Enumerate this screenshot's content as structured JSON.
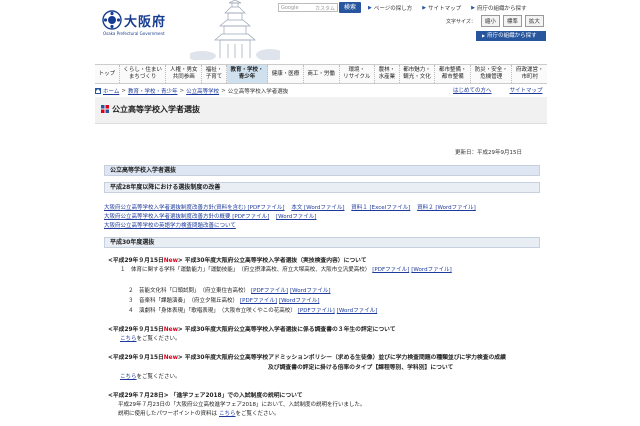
{
  "header": {
    "logo_text": "大阪府",
    "logo_sub": "Osaka Prefectural Government",
    "search_placeholder": "Google",
    "search_hint": "カスタム",
    "search_button": "検索",
    "util_links": [
      "ページの探し方",
      "サイトマップ",
      "府庁の組織から探す"
    ],
    "textsize_label": "文字サイズ：",
    "textsize_buttons": [
      "縮小",
      "標準",
      "拡大"
    ],
    "lang_label": "府庁の組織から探す"
  },
  "nav": {
    "items": [
      "トップ",
      "くらし・住まい\nまちづくり",
      "人権・男女\n共同参画",
      "福祉・\n子育て",
      "教育・学校・\n青少年",
      "健康・医療",
      "商工・労働",
      "環境・\nリサイクル",
      "農林・\n水産業",
      "都市魅力・\n観光・文化",
      "都市整備・\n都市整備",
      "防災・安全・\n危機管理",
      "府政運営・\n市町村"
    ],
    "active_index": 4
  },
  "breadcrumb": {
    "items": [
      "ホーム",
      "教育・学校・青少年",
      "公立高等学校",
      "公立高等学校入学者選抜"
    ],
    "right_links": [
      "はじめての方へ",
      "サイトマップ"
    ]
  },
  "page": {
    "title": "公立高等学校入学者選抜",
    "updated": "更新日：平成29年9月15日"
  },
  "sections": {
    "main_title": "公立高等学校入学者選抜",
    "sec28_title": "平成28年度以降における選抜制度の改善",
    "sec28_line1_text": "大阪府公立高等学校入学者選抜制度改善方針(資料を含む) [PDFファイル]",
    "sec28_line1_link2": "本文 [Wordファイル]",
    "sec28_line1_link3": "資料１ [Excelファイル]",
    "sec28_line1_link4": "資料２ [Wordファイル]",
    "sec28_line2": "大阪府公立高等学校入学者選抜制度改善方針の概要 [PDFファイル]",
    "sec28_line2_link2": "[Wordファイル]",
    "sec28_line3": "大阪府公立高等学校の英語学力検査問題改善について",
    "sec30_title": "平成30年度選抜"
  },
  "entries": {
    "e1_date": "<平成29年９月15日",
    "e1_new": "New",
    "e1_title": "> 平成30年度大阪府公立高等学校入学者選抜（実技検査内容）について",
    "e1_l1": "１　体育に関する学科「運動能力」「運動技能」　（府立摂津高校、府立大塚高校、大阪市立汎愛高校）",
    "e1_l1_pdf": "[PDFファイル]",
    "e1_l1_word": "[Wordファイル]",
    "e1_l2": "２　芸能文化科「口頭試問」　（府立東住吉高校）",
    "e1_l2_pdf": "[PDFファイル]",
    "e1_l2_word": "[Wordファイル]",
    "e1_l3": "３　音楽科「課題演奏」　（府立夕陽丘高校）",
    "e1_l3_pdf": "[PDFファイル]",
    "e1_l3_word": "[Wordファイル]",
    "e1_l4": "４　演劇科「身体表現」「歌唱表現」　（大阪市立咲くやこの花高校）",
    "e1_l4_pdf": "[PDFファイル]",
    "e1_l4_word": "[Wordファイル]",
    "e2_date": "<平成29年９月15日",
    "e2_new": "New",
    "e2_title": "> 平成30年度大阪府公立高等学校入学者選抜に係る調査書の３年生の評定について",
    "e2_link": "こちら",
    "e2_after": "をご覧ください。",
    "e3_date": "<平成29年９月15日",
    "e3_new": "New",
    "e3_title": "> 平成30年度大阪府公立高等学校アドミッションポリシー（求める生徒像）並びに学力検査問題の種類並びに学力検査の成績",
    "e3_title2": "及び調査書の評定に掛ける倍率のタイプ【課程等別、学科別】について",
    "e3_link": "こちら",
    "e3_after": "をご覧ください。",
    "e4_date": "<平成29年７月28日",
    "e4_title": "> 「進学フェア2018」での入試制度の説明について",
    "e4_l1": "平成29年７月23日の「大阪府公立高校進学フェア2018」において、入試制度の説明を行いました。",
    "e4_l2": "説明に使用したパワーポイントの資料は",
    "e4_link": "こちら",
    "e4_after": "をご覧ください。"
  }
}
